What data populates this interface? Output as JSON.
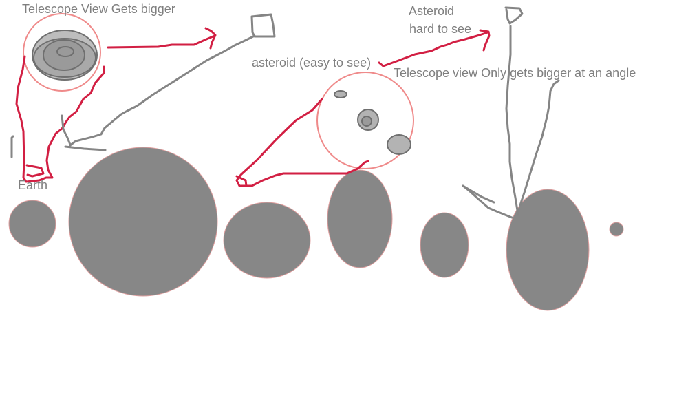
{
  "labels": {
    "telescope_view_bigger": "Telescope View Gets bigger",
    "asteroid": "Asteroid",
    "hard_to_see": "hard to see",
    "asteroid_easy": "asteroid (easy to see)",
    "telescope_angle": "Telescope view Only gets bigger at an angle",
    "earth": "Earth"
  },
  "colors": {
    "ink_red": "#d21f43",
    "ink_gray": "#858585",
    "ring_pink": "#ef8a8a",
    "body_gray": "#878787",
    "text_gray": "#7f7f7f"
  }
}
